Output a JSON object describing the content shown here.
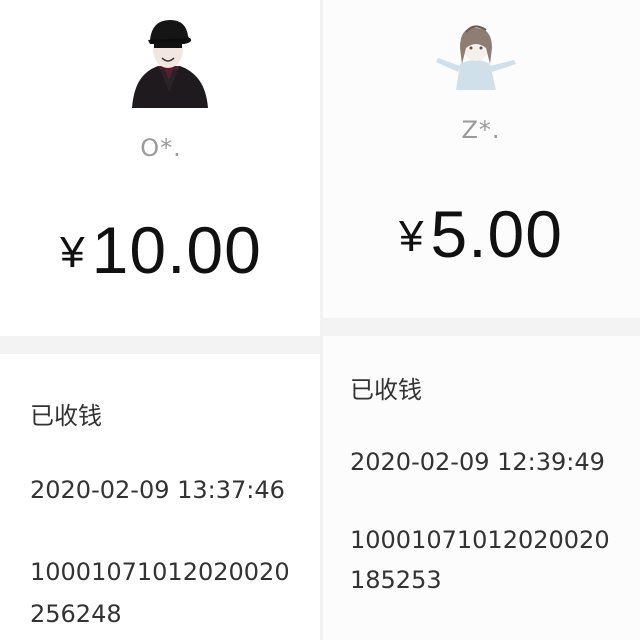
{
  "receipts": [
    {
      "payer_name": "O*.",
      "currency_symbol": "¥",
      "amount": "10.00",
      "status": "已收钱",
      "time": "2020-02-09 13:37:46",
      "order_line1": "10001071012020020",
      "order_line2": "256248",
      "avatar_icon": "man-in-black-cap-avatar-icon"
    },
    {
      "payer_name": "Z*.",
      "currency_symbol": "¥",
      "amount": "5.00",
      "status": "已收钱",
      "time": "2020-02-09 12:39:49",
      "order_line1": "10001071012020020",
      "order_line2": "185253",
      "avatar_icon": "girl-sketch-avatar-icon"
    }
  ]
}
